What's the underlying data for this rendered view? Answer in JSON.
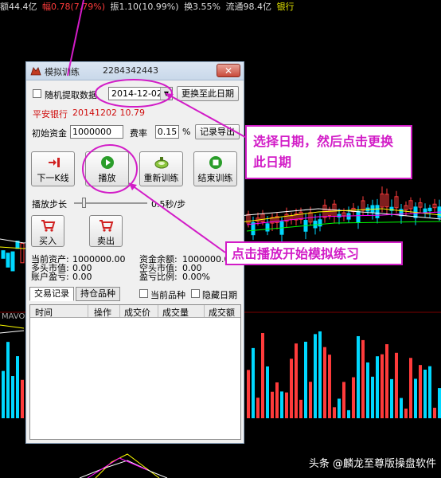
{
  "topbar": {
    "amount": "额44.4亿",
    "change": "幅0.78(7.79%)",
    "amplitude": "振1.10(10.99%)",
    "turnover": "换3.55%",
    "float": "流通98.4亿",
    "sector": "银行"
  },
  "chart": {
    "indicator_label": "MAVO",
    "colors": {
      "up": "#ff3b3b",
      "down": "#00d8ff",
      "ma1": "#ffffff",
      "ma2": "#ffff00",
      "ma3": "#ff00ff",
      "ma4": "#00ff00"
    }
  },
  "window": {
    "title": "模拟训练",
    "account_id": "2284342443",
    "random_fetch_label": "随机提取数据",
    "date_value": "2014-12-02",
    "change_date_button": "更换至此日期",
    "stock_name": "平安银行",
    "stock_info": "20141202  10.79",
    "initial_capital_label": "初始资金",
    "initial_capital_value": "1000000",
    "fee_rate_label": "费率",
    "fee_rate_value": "0.15",
    "fee_rate_unit": "%",
    "export_button": "记录导出",
    "next_k_button": "下一K线",
    "play_button": "播放",
    "restart_button": "重新训练",
    "end_button": "结束训练",
    "step_label": "播放步长",
    "step_value": "0.5秒/步",
    "buy_button": "买入",
    "sell_button": "卖出",
    "stats": {
      "current_assets_label": "当前资产:",
      "current_assets_value": "1000000.00",
      "cash_balance_label": "资金余额:",
      "cash_balance_value": "1000000.00",
      "long_value_label": "多头市值:",
      "long_value_value": "0.00",
      "short_value_label": "空头市值:",
      "short_value_value": "0.00",
      "account_pnl_label": "账户盈亏:",
      "account_pnl_value": "0.00",
      "pnl_ratio_label": "盈亏比例:",
      "pnl_ratio_value": "0.00%"
    },
    "tabs": [
      "交易记录",
      "持仓品种"
    ],
    "current_symbol_label": "当前品种",
    "hide_date_label": "隐藏日期",
    "table_headers": [
      "时间",
      "操作",
      "成交价",
      "成交量",
      "成交额"
    ]
  },
  "annotations": {
    "date_tip": "选择日期，然后点击更换此日期",
    "play_tip": "点击播放开始模拟练习",
    "accent_color": "#d21cc7"
  },
  "watermark": "头条 @麟龙至尊版操盘软件"
}
